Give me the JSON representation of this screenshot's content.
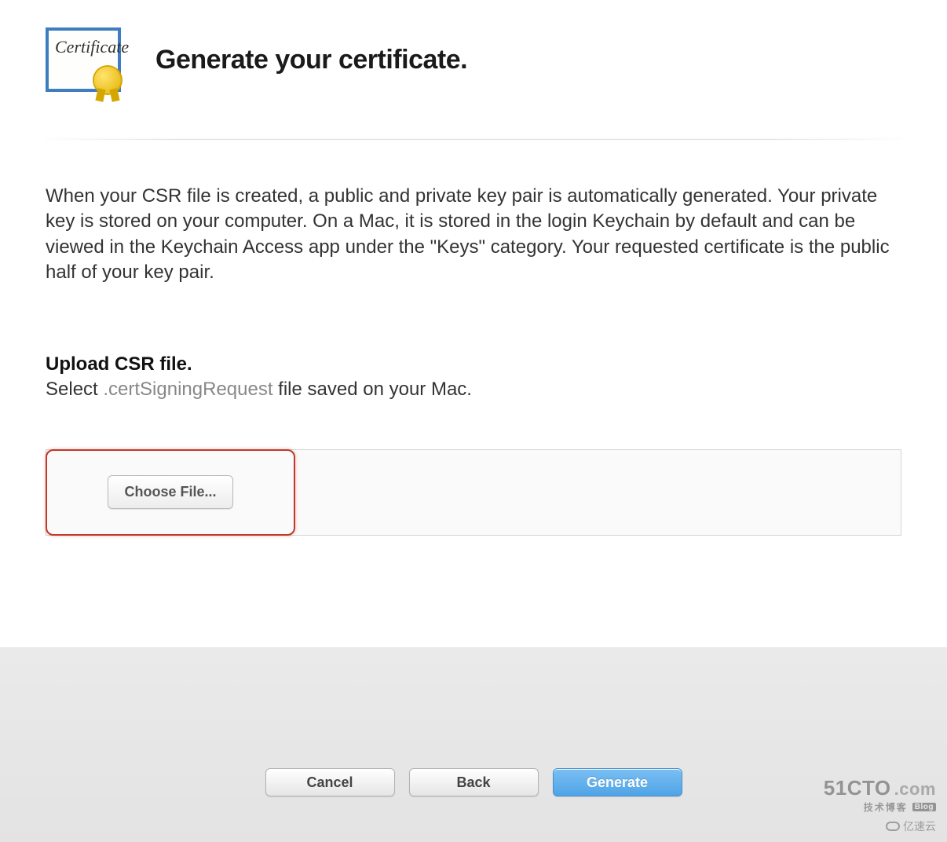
{
  "header": {
    "icon_word": "Certificate",
    "title": "Generate your certificate."
  },
  "description": "When your CSR file is created, a public and private key pair is automatically generated. Your private key is stored on your computer. On a Mac, it is stored in the login Keychain by default and can be viewed in the Keychain Access app under the \"Keys\" category. Your requested certificate is the public half of your key pair.",
  "upload": {
    "heading": "Upload CSR file.",
    "select_prefix": "Select ",
    "filetype": ".certSigningRequest",
    "select_suffix": " file saved on your Mac.",
    "choose_label": "Choose File..."
  },
  "buttons": {
    "cancel": "Cancel",
    "back": "Back",
    "generate": "Generate"
  },
  "watermark": {
    "line1a": "51CTO",
    "line1b": ".com",
    "line2a": "技术博客",
    "line2b": "Blog",
    "line3": "亿速云"
  }
}
